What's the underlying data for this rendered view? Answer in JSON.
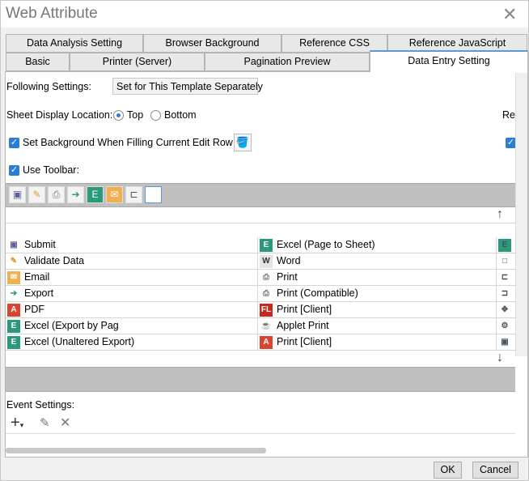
{
  "window": {
    "title": "Web Attribute",
    "close": "✕"
  },
  "tabs_row1": [
    "Data Analysis Setting",
    "Browser Background",
    "Reference CSS",
    "Reference JavaScript"
  ],
  "tabs_row2": [
    "Basic",
    "Printer (Server)",
    "Pagination Preview",
    "Data Entry Setting"
  ],
  "following": {
    "label": "Following Settings:",
    "value": "Set for This Template Separately"
  },
  "sheet_display": {
    "label": "Sheet Display Location:",
    "top": "Top",
    "bottom": "Bottom",
    "selected": "Top",
    "right_cut": "Re"
  },
  "set_background": {
    "label": "Set Background When Filling Current Edit Row:",
    "checked": true
  },
  "use_toolbar": {
    "label": "Use Toolbar:",
    "checked": true
  },
  "list": {
    "col1": [
      {
        "icon": "save",
        "label": "Submit"
      },
      {
        "icon": "validate",
        "label": "Validate Data"
      },
      {
        "icon": "email",
        "label": "Email"
      },
      {
        "icon": "export",
        "label": "Export"
      },
      {
        "icon": "pdf",
        "label": "PDF"
      },
      {
        "icon": "excel",
        "label": "Excel (Export by Pag"
      },
      {
        "icon": "excel",
        "label": "Excel (Unaltered Export)"
      }
    ],
    "col2": [
      {
        "icon": "excel",
        "label": "Excel (Page to Sheet)"
      },
      {
        "icon": "word",
        "label": "Word"
      },
      {
        "icon": "print",
        "label": "Print"
      },
      {
        "icon": "print",
        "label": "Print (Compatible)"
      },
      {
        "icon": "flash",
        "label": "Print [Client]"
      },
      {
        "icon": "applet",
        "label": "Applet Print"
      },
      {
        "icon": "pdf",
        "label": "Print [Client]"
      }
    ]
  },
  "event_settings": {
    "label": "Event Settings:"
  },
  "buttons": {
    "ok": "OK",
    "cancel": "Cancel"
  }
}
